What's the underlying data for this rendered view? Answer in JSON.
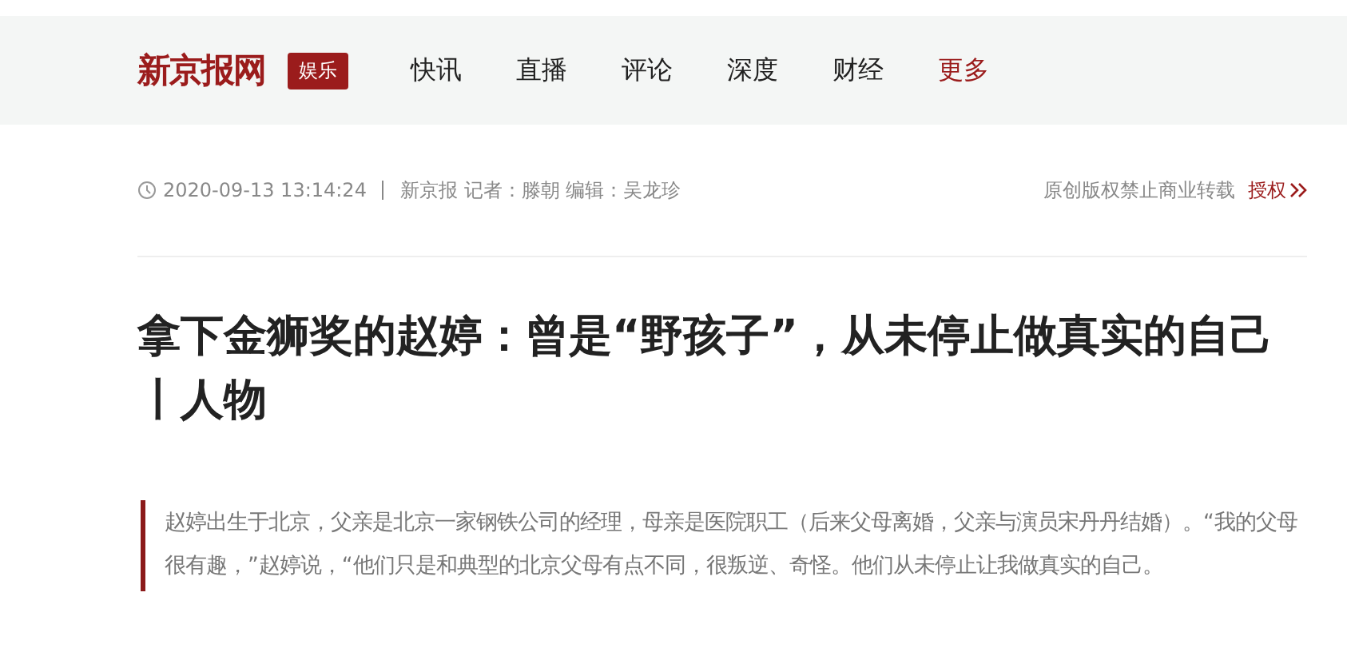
{
  "header": {
    "logo": "新京报网",
    "channel": "娱乐",
    "nav": [
      {
        "label": "快讯",
        "color": "#222222"
      },
      {
        "label": "直播",
        "color": "#222222"
      },
      {
        "label": "评论",
        "color": "#222222"
      },
      {
        "label": "深度",
        "color": "#222222"
      },
      {
        "label": "财经",
        "color": "#222222"
      },
      {
        "label": "更多",
        "color": "#9b1c1c"
      }
    ]
  },
  "meta": {
    "time": "2020-09-13 13:14:24",
    "byline": "新京报 记者：滕朝 编辑：吴龙珍",
    "copyright": "原创版权禁止商业转载",
    "license_link": "授权"
  },
  "article": {
    "title": "拿下金狮奖的赵婷：曾是“野孩子”，从未停止做真实的自己丨人物",
    "quote": "赵婷出生于北京，父亲是北京一家钢铁公司的经理，母亲是医院职工（后来父母离婚，父亲与演员宋丹丹结婚）。“我的父母很有趣，”赵婷说，“他们只是和典型的北京父母有点不同，很叛逆、奇怪。他们从未停止让我做真实的自己。"
  }
}
